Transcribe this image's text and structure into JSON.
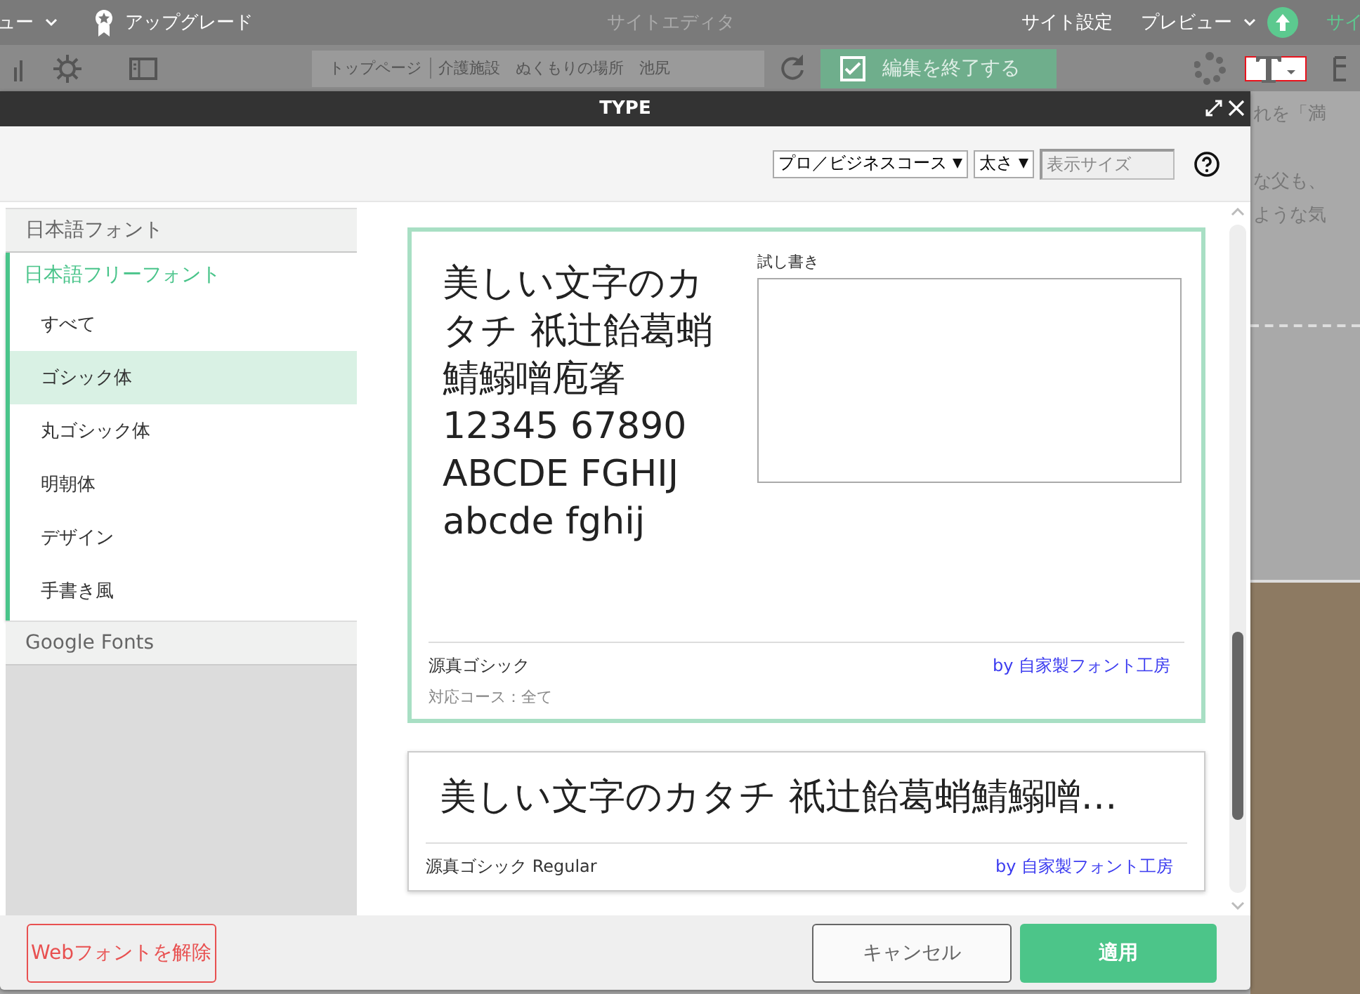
{
  "topbar": {
    "menu_label": "ュー",
    "upgrade": "アップグレード",
    "title": "サイトエディタ",
    "site_settings": "サイト設定",
    "preview": "プレビュー",
    "publish": "サイ"
  },
  "toolbar": {
    "crumb": "トップページ",
    "page_title": "介護施設　ぬくもりの場所　池尻",
    "finish": "編集を終了する",
    "text_tool_selected": true
  },
  "background_text": [
    "れを「満",
    "な父も、",
    "ような気"
  ],
  "modal": {
    "title": "TYPE",
    "filters": {
      "course": "プロ／ビジネスコース",
      "weight": "太さ",
      "size_placeholder": "表示サイズ"
    },
    "sidebar": [
      {
        "label": "日本語フォント",
        "expanded": false
      },
      {
        "label": "日本語フリーフォント",
        "expanded": true,
        "items": [
          {
            "label": "すべて",
            "selected": false
          },
          {
            "label": "ゴシック体",
            "selected": true
          },
          {
            "label": "丸ゴシック体",
            "selected": false
          },
          {
            "label": "明朝体",
            "selected": false
          },
          {
            "label": "デザイン",
            "selected": false
          },
          {
            "label": "手書き風",
            "selected": false
          }
        ]
      },
      {
        "label": "Google Fonts",
        "expanded": false
      }
    ],
    "fonts": [
      {
        "kind": "expanded",
        "selected": true,
        "sample_lines": [
          "美しい文字のカ",
          "タチ 祇辻飴葛蛸",
          "鯖鰯噌庖箸",
          "12345 67890",
          "ABCDE FGHIJ",
          "abcde fghij"
        ],
        "trial_label": "試し書き",
        "name": "源真ゴシック",
        "author": "by 自家製フォント工房",
        "course": "対応コース：全て"
      },
      {
        "kind": "compact",
        "selected": false,
        "sample": "美しい文字のカタチ 祇辻飴葛蛸鯖鰯噌…",
        "name": "源真ゴシック Regular",
        "author": "by 自家製フォント工房"
      }
    ],
    "footer": {
      "remove": "Webフォントを解除",
      "cancel": "キャンセル",
      "apply": "適用"
    }
  }
}
